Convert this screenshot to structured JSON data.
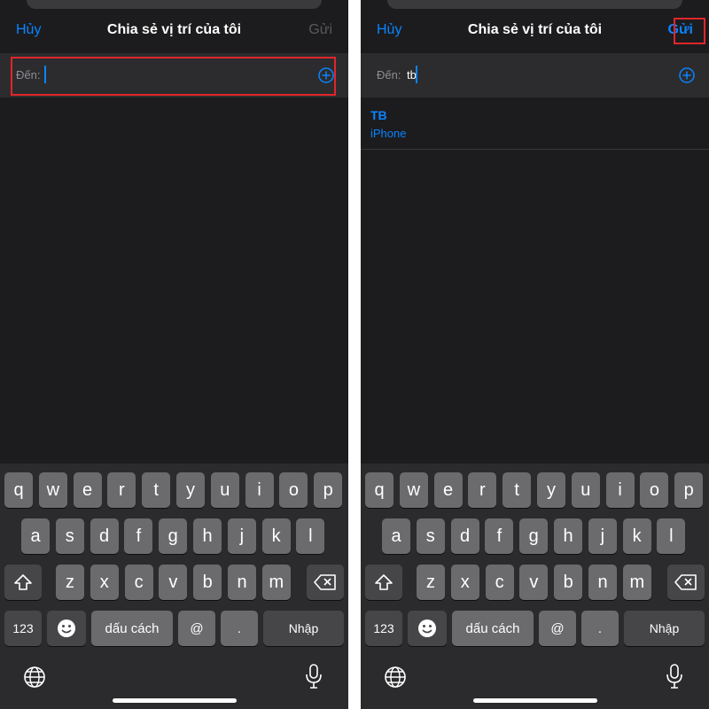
{
  "screens": [
    {
      "id": "left",
      "header": {
        "cancel_label": "Hủy",
        "title": "Chia sẻ vị trí của tôi",
        "send_label": "Gửi",
        "send_state": "disabled"
      },
      "to_field": {
        "label": "Đến:",
        "value": ""
      },
      "highlight": "to-field",
      "suggestions": []
    },
    {
      "id": "right",
      "header": {
        "cancel_label": "Hủy",
        "title": "Chia sẻ vị trí của tôi",
        "send_label": "Gửi",
        "send_state": "enabled"
      },
      "to_field": {
        "label": "Đến:",
        "value": "tb"
      },
      "highlight": "send-button",
      "suggestions": [
        {
          "name": "TB",
          "detail": "iPhone"
        }
      ]
    }
  ],
  "keyboard": {
    "row1": [
      "q",
      "w",
      "e",
      "r",
      "t",
      "y",
      "u",
      "i",
      "o",
      "p"
    ],
    "row2": [
      "a",
      "s",
      "d",
      "f",
      "g",
      "h",
      "j",
      "k",
      "l"
    ],
    "row3": [
      "z",
      "x",
      "c",
      "v",
      "b",
      "n",
      "m"
    ],
    "numbers_label": "123",
    "space_label": "dấu cách",
    "at_label": "@",
    "dot_label": ".",
    "return_label": "Nhập"
  },
  "icons": {
    "add": "plus-circle-icon",
    "shift": "shift-arrow-icon",
    "delete": "backspace-icon",
    "emoji": "emoji-icon",
    "globe": "globe-icon",
    "mic": "microphone-icon"
  },
  "colors": {
    "accent": "#0a84ff",
    "background": "#1c1c1e",
    "field": "#2c2c2e",
    "keyboard": "#2b2b2d",
    "key": "#6b6b6e",
    "special_key": "#464649",
    "highlight": "#e0262b",
    "disabled": "#5a5a5e"
  }
}
